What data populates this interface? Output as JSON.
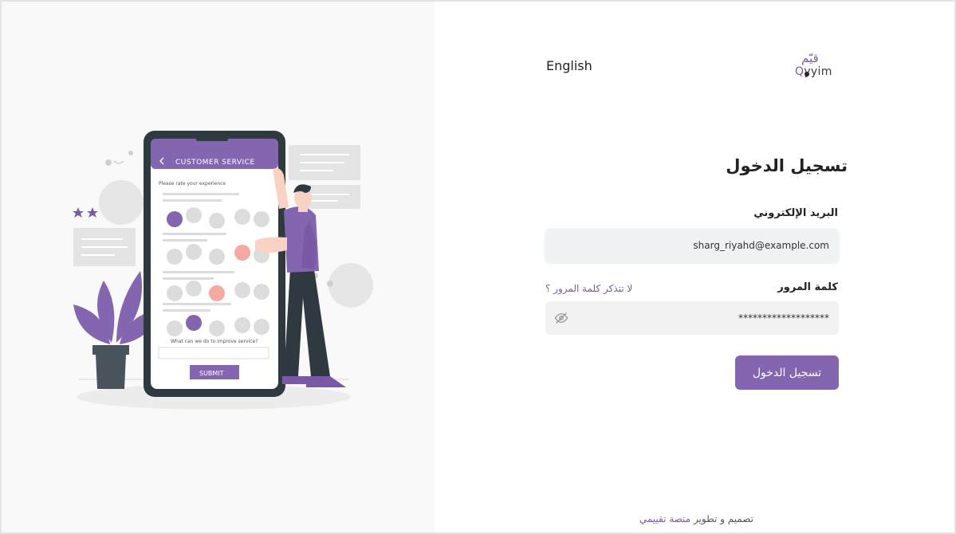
{
  "header": {
    "language_toggle": "English",
    "logo_arabic": "قيّم",
    "logo_english": "yyim",
    "logo_english_q": "Q"
  },
  "illustration": {
    "screen_title": "CUSTOMER SERVICE",
    "prompt": "Please rate your experience",
    "question": "What can we do to improve service?",
    "submit_label": "SUBMIT"
  },
  "login": {
    "title": "تسجيل الدخول",
    "email_label": "البريد الإلكتروني",
    "email_value": "sharg_riyahd@example.com",
    "password_label": "كلمة المرور",
    "forgot_link": "لا تتذكر كلمة المرور ؟",
    "password_value": "*******************",
    "submit_button": "تسجيل الدخول"
  },
  "footer": {
    "text": "تصميم و تطوير",
    "brand": "منصة تقييمي"
  },
  "colors": {
    "accent": "#8466b0",
    "link": "#7a5aa6",
    "field_bg": "#f2f2f2"
  }
}
